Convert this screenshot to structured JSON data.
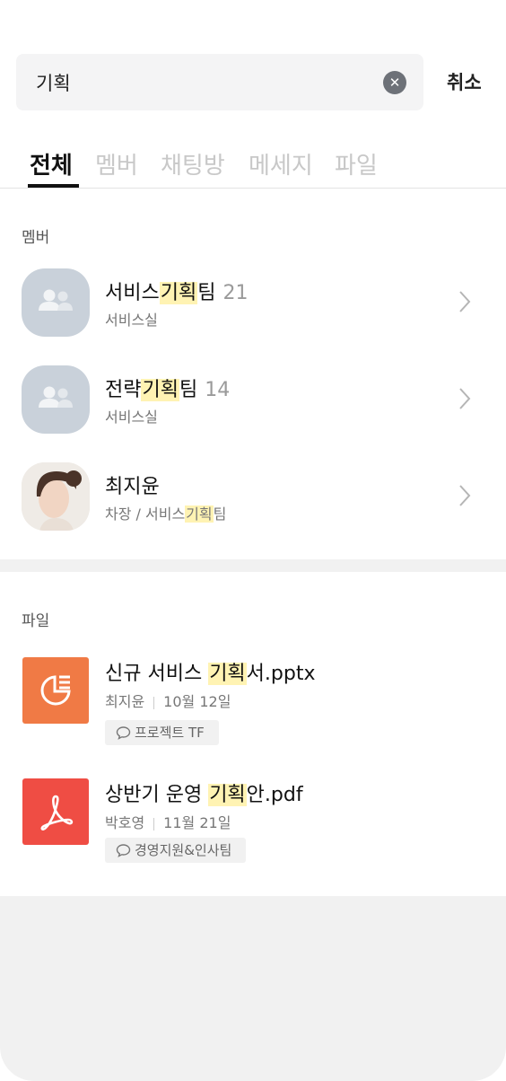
{
  "search": {
    "value": "기획",
    "cancel_label": "취소"
  },
  "tabs": [
    {
      "label": "전체",
      "active": true
    },
    {
      "label": "멤버",
      "active": false
    },
    {
      "label": "채팅방",
      "active": false
    },
    {
      "label": "메세지",
      "active": false
    },
    {
      "label": "파일",
      "active": false
    }
  ],
  "members_section": {
    "label": "멤버",
    "items": [
      {
        "name_before": "서비스",
        "name_highlight": "기획",
        "name_after": "팀",
        "count": "21",
        "sub": "서비스실",
        "avatar": "group-icon"
      },
      {
        "name_before": "전략",
        "name_highlight": "기획",
        "name_after": "팀",
        "count": "14",
        "sub": "서비스실",
        "avatar": "group-icon"
      },
      {
        "name_before": "최지윤",
        "name_highlight": "",
        "name_after": "",
        "count": "",
        "sub_before": "차장 / 서비스",
        "sub_highlight": "기획",
        "sub_after": "팀",
        "avatar": "profile-photo"
      }
    ]
  },
  "files_section": {
    "label": "파일",
    "items": [
      {
        "name_before": "신규 서비스 ",
        "name_highlight": "기획",
        "name_after": "서.pptx",
        "author": "최지윤",
        "date": "10월 12일",
        "tag": "프로젝트 TF",
        "icon": "presentation-icon",
        "color": "#f07a45"
      },
      {
        "name_before": "상반기 운영 ",
        "name_highlight": "기획",
        "name_after": "안.pdf",
        "author": "박호영",
        "date": "11월 21일",
        "tag": "경영지원&인사팀",
        "icon": "pdf-icon",
        "color": "#ef4d44"
      }
    ]
  },
  "colors": {
    "highlight": "#fff3b3",
    "avatar_group_bg": "#c9d1da"
  }
}
